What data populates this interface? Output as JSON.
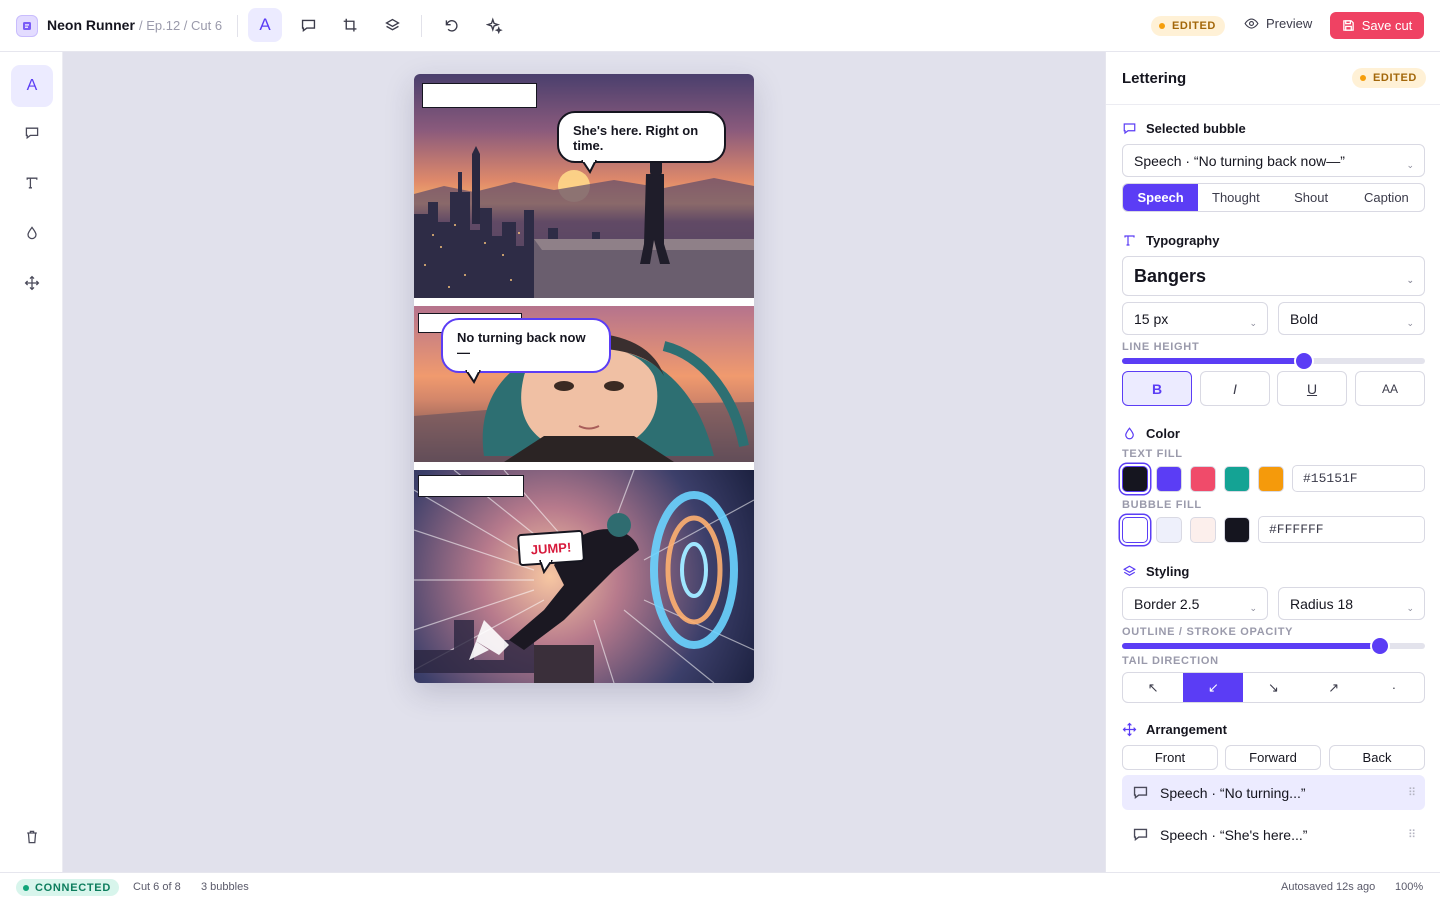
{
  "header": {
    "project": "Neon Runner",
    "breadcrumb": "/ Ep.12 / Cut 6",
    "edited_badge": "EDITED",
    "preview_label": "Preview",
    "save_label": "Save cut"
  },
  "toolbar": {
    "tools": [
      "text-tool",
      "bubble-tool",
      "crop-tool",
      "layers-tool",
      "undo",
      "magic-tool"
    ],
    "active_tool": "text-tool",
    "text_tool_glyph": "A"
  },
  "left_rail": {
    "items": [
      "text",
      "bubble",
      "typography",
      "color",
      "move"
    ],
    "active": "text",
    "text_glyph": "A"
  },
  "canvas": {
    "bubbles": {
      "panel1_speech": "She's here. Right on time.",
      "panel2_speech": "No turning back now—",
      "panel3_shout": "JUMP!"
    }
  },
  "lettering": {
    "title": "Lettering",
    "edited_badge": "EDITED",
    "selected_bubble": {
      "section": "Selected bubble",
      "value": "Speech · “No turning back now—”",
      "types": [
        "Speech",
        "Thought",
        "Shout",
        "Caption"
      ],
      "active_type": "Speech"
    },
    "typography": {
      "section": "Typography",
      "font": "Bangers",
      "size": "15 px",
      "weight": "Bold",
      "line_height_label": "LINE HEIGHT",
      "line_height_level": 0.6,
      "format_buttons": [
        "B",
        "I",
        "U",
        "AA"
      ],
      "format_active": "B"
    },
    "color": {
      "section": "Color",
      "text_fill_label": "TEXT FILL",
      "text_swatches": [
        "#15151F",
        "#5B3DF5",
        "#F04B6A",
        "#14A394",
        "#F59A0B"
      ],
      "text_hex": "#15151F",
      "bubble_fill_label": "BUBBLE FILL",
      "bubble_swatches": [
        "#FFFFFF",
        "#EEF0FB",
        "#FCEFEC",
        "#15151F"
      ],
      "bubble_hex": "#FFFFFF"
    },
    "styling": {
      "section": "Styling",
      "border": "Border 2.5",
      "radius": "Radius 18",
      "opacity_label": "OUTLINE / STROKE OPACITY",
      "opacity_level": 0.85,
      "tail_label": "TAIL DIRECTION",
      "tail_options": [
        "↖",
        "↙",
        "↘",
        "↗",
        "·"
      ],
      "tail_active": "↙"
    },
    "arrangement": {
      "section": "Arrangement",
      "buttons": [
        "Front",
        "Forward",
        "Back"
      ],
      "layers": [
        "Speech · “No turning...”",
        "Speech · “She's here...”"
      ],
      "active_layer": 0
    }
  },
  "status": {
    "connection": "CONNECTED",
    "cut": "Cut 6 of 8",
    "bubbles": "3 bubbles",
    "autosave": "Autosaved 12s ago",
    "zoom": "100%"
  },
  "colors": {
    "accent": "#5B3DF5",
    "save": "#EF4263",
    "edited_badge_bg": "#FFF1D6",
    "connected_bg": "#D8F5EC"
  }
}
